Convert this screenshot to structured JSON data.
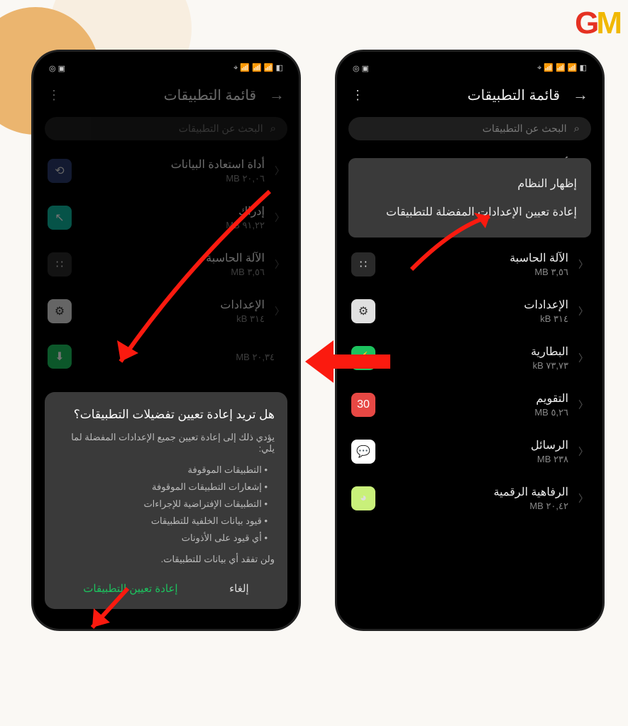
{
  "logo": {
    "g": "G",
    "m": "M"
  },
  "status": {
    "left_icons": "◎ ▣",
    "right_icons": "⌖ 📶 📶 📶 ◧"
  },
  "header": {
    "title": "قائمة التطبيقات",
    "back_glyph": "→",
    "more_glyph": "⋮"
  },
  "search": {
    "placeholder": "البحث عن التطبيقات",
    "icon": "⌕"
  },
  "menu": {
    "show_system": "إظهار النظام",
    "reset_prefs": "إعادة تعيين الإعدادات المفضلة للتطبيقات"
  },
  "apps": [
    {
      "name": "أداة استعادة البيانات",
      "size": "٢٠,٠٦ MB",
      "icon_class": "ic-blue",
      "glyph": "⟲"
    },
    {
      "name": "إدراك",
      "size": "٩١,٢٢ MB",
      "icon_class": "ic-teal",
      "glyph": "↖"
    },
    {
      "name": "الآلة الحاسبة",
      "size": "٣,٥٦ MB",
      "icon_class": "ic-dark",
      "glyph": "∷"
    },
    {
      "name": "الإعدادات",
      "size": "٣١٤ kB",
      "icon_class": "ic-gear",
      "glyph": "⚙"
    },
    {
      "name": "البطارية",
      "size": "٧٣,٧٣ kB",
      "icon_class": "ic-green",
      "glyph": "⚡"
    },
    {
      "name": "التقويم",
      "size": "٥,٢٦ MB",
      "icon_class": "ic-red",
      "glyph": "30"
    },
    {
      "name": "الرسائل",
      "size": "٢٣٨ MB",
      "icon_class": "ic-white",
      "glyph": "💬"
    },
    {
      "name": "الرفاهية الرقمية",
      "size": "٢٠,٤٢ MB",
      "icon_class": "ic-lime",
      "glyph": "◕"
    }
  ],
  "apps_left_visible": 4,
  "left_partial_size": "٢٠,٣٤ MB",
  "dialog": {
    "title": "هل تريد إعادة تعيين تفضيلات التطبيقات؟",
    "subtitle": "يؤدي ذلك إلى إعادة تعيين جميع الإعدادات المفضلة لما يلي:",
    "bullets": [
      "التطبيقات الموقوفة",
      "إشعارات التطبيقات الموقوفة",
      "التطبيقات الإفتراضية للإجراءات",
      "قيود بيانات الخلفية للتطبيقات",
      "أي قيود على الأذونات"
    ],
    "note": "ولن تفقد أي بيانات للتطبيقات.",
    "primary": "إعادة تعيين التطبيقات",
    "secondary": "إلغاء"
  }
}
